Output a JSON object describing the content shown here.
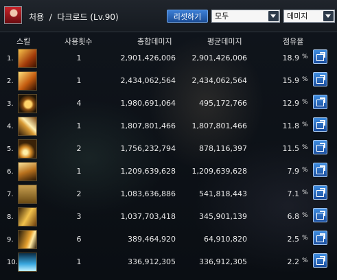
{
  "header": {
    "character_name": "처용  /  다크로드 (Lv.90)",
    "reset_label": "리셋하기",
    "filter_select": "모두",
    "type_select": "데미지"
  },
  "columns": {
    "skill": "스킬",
    "use_count": "사용횟수",
    "total_damage": "총합데미지",
    "avg_damage": "평균데미지",
    "share": "점유율"
  },
  "rows": [
    {
      "idx": "1.",
      "icon": "flame-slash-icon",
      "count": "1",
      "total": "2,901,426,006",
      "avg": "2,901,426,006",
      "pct": "18.9",
      "pct_unit": "%"
    },
    {
      "idx": "2.",
      "icon": "dragon-fire-icon",
      "count": "1",
      "total": "2,434,062,564",
      "avg": "2,434,062,564",
      "pct": "15.9",
      "pct_unit": "%"
    },
    {
      "idx": "3.",
      "icon": "golden-orb-icon",
      "count": "4",
      "total": "1,980,691,064",
      "avg": "495,172,766",
      "pct": "12.9",
      "pct_unit": "%"
    },
    {
      "idx": "4.",
      "icon": "golden-slash-icon",
      "count": "1",
      "total": "1,807,801,466",
      "avg": "1,807,801,466",
      "pct": "11.8",
      "pct_unit": "%"
    },
    {
      "idx": "5.",
      "icon": "spiral-burst-icon",
      "count": "2",
      "total": "1,756,232,794",
      "avg": "878,116,397",
      "pct": "11.5",
      "pct_unit": "%"
    },
    {
      "idx": "6.",
      "icon": "claw-strike-icon",
      "count": "1",
      "total": "1,209,639,628",
      "avg": "1,209,639,628",
      "pct": "7.9",
      "pct_unit": "%"
    },
    {
      "idx": "7.",
      "icon": "gate-seal-icon",
      "count": "2",
      "total": "1,083,636,886",
      "avg": "541,818,443",
      "pct": "7.1",
      "pct_unit": "%"
    },
    {
      "idx": "8.",
      "icon": "double-slash-icon",
      "count": "3",
      "total": "1,037,703,418",
      "avg": "345,901,139",
      "pct": "6.8",
      "pct_unit": "%"
    },
    {
      "idx": "9.",
      "icon": "dash-cut-icon",
      "count": "6",
      "total": "389,464,920",
      "avg": "64,910,820",
      "pct": "2.5",
      "pct_unit": "%"
    },
    {
      "idx": "10.",
      "icon": "ice-pillar-icon",
      "count": "1",
      "total": "336,912,305",
      "avg": "336,912,305",
      "pct": "2.2",
      "pct_unit": "%"
    }
  ]
}
